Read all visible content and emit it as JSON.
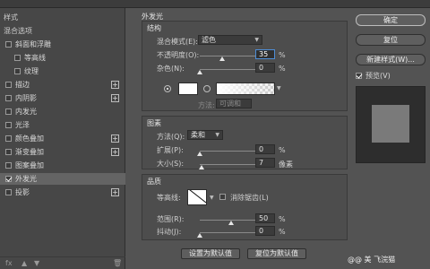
{
  "left_panel": {
    "items": [
      {
        "label": "样式",
        "checkbox": false,
        "checked": false,
        "plus": false,
        "selected": false,
        "indent": 0
      },
      {
        "label": "混合选项",
        "checkbox": false,
        "checked": false,
        "plus": false,
        "selected": false,
        "indent": 0
      },
      {
        "label": "斜面和浮雕",
        "checkbox": true,
        "checked": false,
        "plus": false,
        "selected": false,
        "indent": 0
      },
      {
        "label": "等高线",
        "checkbox": true,
        "checked": false,
        "plus": false,
        "selected": false,
        "indent": 1
      },
      {
        "label": "纹理",
        "checkbox": true,
        "checked": false,
        "plus": false,
        "selected": false,
        "indent": 1
      },
      {
        "label": "描边",
        "checkbox": true,
        "checked": false,
        "plus": true,
        "selected": false,
        "indent": 0
      },
      {
        "label": "内阴影",
        "checkbox": true,
        "checked": false,
        "plus": true,
        "selected": false,
        "indent": 0
      },
      {
        "label": "内发光",
        "checkbox": true,
        "checked": false,
        "plus": false,
        "selected": false,
        "indent": 0
      },
      {
        "label": "光泽",
        "checkbox": true,
        "checked": false,
        "plus": false,
        "selected": false,
        "indent": 0
      },
      {
        "label": "颜色叠加",
        "checkbox": true,
        "checked": false,
        "plus": true,
        "selected": false,
        "indent": 0
      },
      {
        "label": "渐变叠加",
        "checkbox": true,
        "checked": false,
        "plus": true,
        "selected": false,
        "indent": 0
      },
      {
        "label": "图案叠加",
        "checkbox": true,
        "checked": false,
        "plus": false,
        "selected": false,
        "indent": 0
      },
      {
        "label": "外发光",
        "checkbox": true,
        "checked": true,
        "plus": false,
        "selected": true,
        "indent": 0
      },
      {
        "label": "投影",
        "checkbox": true,
        "checked": false,
        "plus": true,
        "selected": false,
        "indent": 0
      }
    ],
    "footer_icons": [
      "fx-icon",
      "up-arrow-icon",
      "down-arrow-icon",
      "trash-icon"
    ]
  },
  "main": {
    "title": "外发光",
    "structure": {
      "label": "结构",
      "blend_mode_label": "混合模式(E):",
      "blend_mode_value": "滤色",
      "opacity_label": "不透明度(O):",
      "opacity_value": "35",
      "opacity_unit": "%",
      "opacity_level": 0.35,
      "noise_label": "杂色(N):",
      "noise_value": "0",
      "noise_unit": "%",
      "noise_level": 0,
      "color_swatch": "#ffffff"
    },
    "elements": {
      "label": "图素",
      "method_label": "方法(Q):",
      "method_value": "柔和",
      "method_disabled_label": "方法:",
      "method_disabled_value": "可调和",
      "spread_label": "扩展(P):",
      "spread_value": "0",
      "spread_unit": "%",
      "spread_level": 0,
      "size_label": "大小(S):",
      "size_value": "7",
      "size_unit": "像素",
      "size_level": 0.03
    },
    "quality": {
      "label": "品质",
      "contour_label": "等高线:",
      "antialias_label": "消除锯齿(L)",
      "range_label": "范围(R):",
      "range_value": "50",
      "range_unit": "%",
      "range_level": 0.5,
      "jitter_label": "抖动(J):",
      "jitter_value": "0",
      "jitter_unit": "%",
      "jitter_level": 0
    },
    "buttons": {
      "set_default": "设置为默认值",
      "reset_default": "复位为默认值"
    }
  },
  "right_panel": {
    "ok": "确定",
    "reset": "复位",
    "new_style": "新建样式(W)...",
    "preview_label": "预览(V)",
    "preview_checked": true
  },
  "watermark": "@@ 美 飞浣猫"
}
